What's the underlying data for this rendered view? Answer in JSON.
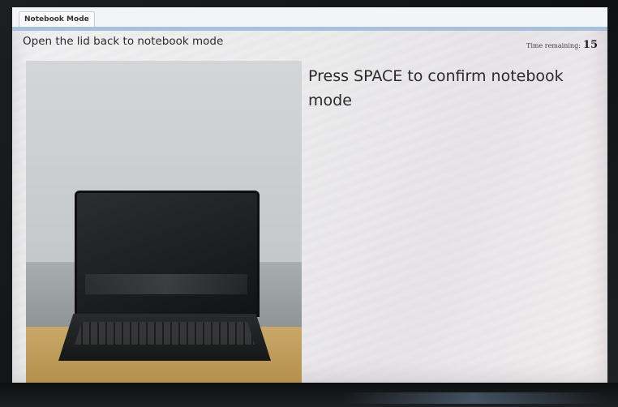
{
  "tab": {
    "label": "Notebook Mode"
  },
  "header": {
    "instruction": "Open the lid back to notebook mode",
    "timer_label": "Time remaining:",
    "timer_value": "15"
  },
  "main": {
    "prompt": "Press SPACE to confirm notebook mode",
    "image_icon": "laptop-photo"
  },
  "colors": {
    "tab_accent": "#a7c1dc",
    "screen_bg": "#f1f2f3"
  }
}
